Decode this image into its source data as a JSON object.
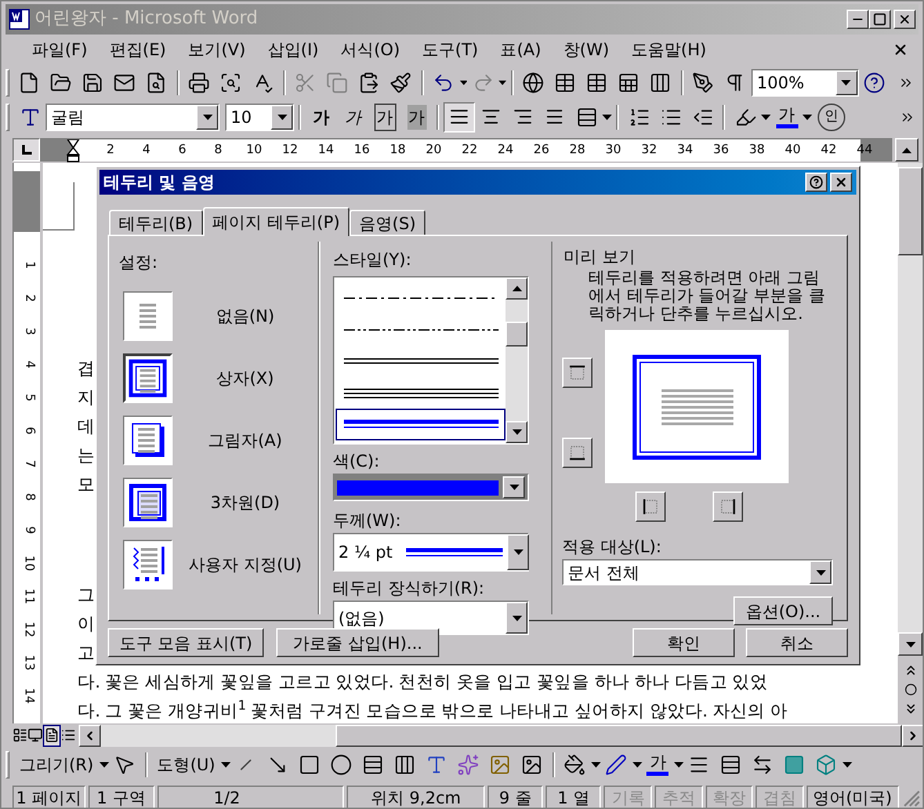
{
  "window": {
    "title": "어린왕자 - Microsoft Word"
  },
  "menu": [
    "파일(F)",
    "편집(E)",
    "보기(V)",
    "삽입(I)",
    "서식(O)",
    "도구(T)",
    "표(A)",
    "창(W)",
    "도움말(H)"
  ],
  "standard_toolbar": {
    "zoom": "100%"
  },
  "formatting_toolbar": {
    "font": "굴림",
    "size": "10",
    "char_buttons": [
      {
        "kind": "bold",
        "text": "가"
      },
      {
        "kind": "italic",
        "text": "가"
      },
      {
        "kind": "boxed",
        "text": "가"
      },
      {
        "kind": "shaded",
        "text": "가"
      }
    ],
    "align_buttons": [
      {
        "kind": "justify",
        "selected": true
      },
      {
        "kind": "center",
        "selected": false
      },
      {
        "kind": "right",
        "selected": false
      },
      {
        "kind": "distributed",
        "selected": false
      }
    ],
    "font_color_text": "가",
    "enclose_text": "인"
  },
  "ruler": {
    "h_numbers": [
      "2",
      "4",
      "6",
      "8",
      "10",
      "12",
      "14",
      "16",
      "18",
      "20",
      "22",
      "24",
      "26",
      "28",
      "30",
      "32",
      "34",
      "36",
      "38",
      "40",
      "42",
      "44"
    ],
    "v_numbers": [
      "1",
      "2",
      "3",
      "4",
      "5",
      "6",
      "7",
      "8",
      "9",
      "10",
      "11",
      "12",
      "13",
      "14"
    ]
  },
  "document": {
    "paragraphs": [
      [
        "겹",
        "지",
        "데",
        "는",
        "모"
      ],
      [
        "그",
        "이",
        "고",
        "다. 꽃은 세심하게 꽃잎을 고르고 있었다. 천천히 옷을 입고 꽃잎을 하나 하나 다듬고 있었",
        "다. 그 꽃은 개양귀비$^{1}$ 꽃처럼 구겨진 모습으로 밖으로 나타내고 싶어하지 않았다. 자신의 아"
      ]
    ]
  },
  "dialog": {
    "title": "테두리 및 음영",
    "tabs": [
      {
        "label": "테두리(B)",
        "selected": false
      },
      {
        "label": "페이지 테두리(P)",
        "selected": true
      },
      {
        "label": "음영(S)",
        "selected": false
      }
    ],
    "setting_label": "설정:",
    "settings": [
      {
        "kind": "none",
        "label": "없음(N)",
        "selected": false
      },
      {
        "kind": "box",
        "label": "상자(X)",
        "selected": true
      },
      {
        "kind": "shadow",
        "label": "그림자(A)",
        "selected": false
      },
      {
        "kind": "threed",
        "label": "3차원(D)",
        "selected": false
      },
      {
        "kind": "custom",
        "label": "사용자 지정(U)",
        "selected": false
      }
    ],
    "style_label": "스타일(Y):",
    "styles": [
      {
        "kind": "dash_dot",
        "selected": false
      },
      {
        "kind": "dash_dot_dot",
        "selected": false
      },
      {
        "kind": "double",
        "selected": false
      },
      {
        "kind": "triple",
        "selected": false
      },
      {
        "kind": "thick_thin",
        "selected": true
      }
    ],
    "color_label": "색(C):",
    "color": "#0000ff",
    "width_label": "두께(W):",
    "width_value": "2 ¼ pt",
    "art_label": "테두리 장식하기(R):",
    "art_value": "(없음)",
    "preview_label": "미리 보기",
    "preview_hint": "테두리를 적용하려면 아래 그림에서 테두리가 들어갈 부분을 클릭하거나 단추를 누르십시오.",
    "apply_label": "적용 대상(L):",
    "apply_value": "문서 전체",
    "options_button": "옵션(O)...",
    "toolbar_button": "도구 모음 표시(T)",
    "hline_button": "가로줄 삽입(H)...",
    "ok_button": "확인",
    "cancel_button": "취소"
  },
  "view_buttons": [
    {
      "kind": "normal",
      "selected": false
    },
    {
      "kind": "web",
      "selected": false
    },
    {
      "kind": "print",
      "selected": true
    },
    {
      "kind": "outline",
      "selected": false
    }
  ],
  "drawing_toolbar": {
    "draw_menu": "그리기(R)",
    "shapes_menu": "도형(U)",
    "font_color_text": "가"
  },
  "status_bar": [
    {
      "text": "1 페이지",
      "disabled": false
    },
    {
      "text": "1 구역",
      "disabled": false
    },
    {
      "text": "1/2",
      "disabled": false
    },
    {
      "text": "위치 9,2cm",
      "disabled": false
    },
    {
      "text": "9 줄",
      "disabled": false
    },
    {
      "text": "1 열",
      "disabled": false
    },
    {
      "text": "기록",
      "disabled": true
    },
    {
      "text": "추적",
      "disabled": true
    },
    {
      "text": "확장",
      "disabled": true
    },
    {
      "text": "겹침",
      "disabled": true
    },
    {
      "text": "영어(미국)",
      "disabled": false
    }
  ]
}
